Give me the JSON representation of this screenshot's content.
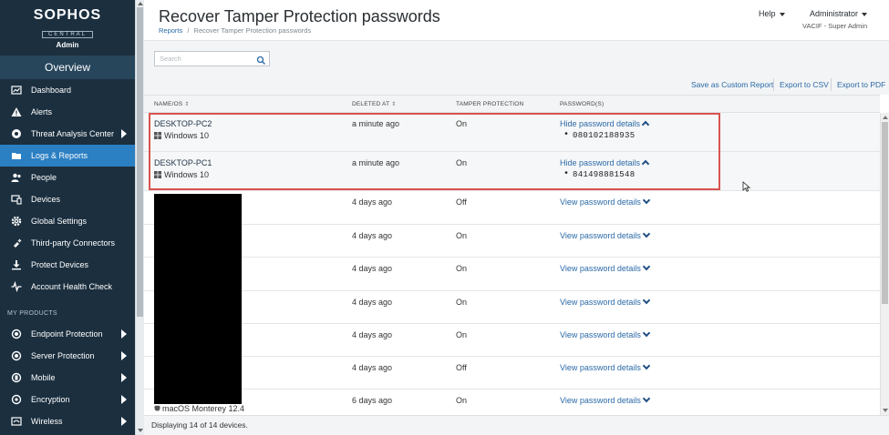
{
  "sidebar": {
    "logo_word": "SOPHOS",
    "logo_sub": "CENTRAL",
    "logo_admin": "Admin",
    "overview": "Overview",
    "items": [
      {
        "label": "Dashboard",
        "icon": "dashboard-icon"
      },
      {
        "label": "Alerts",
        "icon": "alert-icon"
      },
      {
        "label": "Threat Analysis Center",
        "icon": "threat-icon",
        "has_arrow": true
      },
      {
        "label": "Logs & Reports",
        "icon": "folder-icon",
        "active": true
      },
      {
        "label": "People",
        "icon": "people-icon"
      },
      {
        "label": "Devices",
        "icon": "devices-icon"
      },
      {
        "label": "Global Settings",
        "icon": "gear-icon"
      },
      {
        "label": "Third-party Connectors",
        "icon": "plug-icon"
      },
      {
        "label": "Protect Devices",
        "icon": "download-icon"
      },
      {
        "label": "Account Health Check",
        "icon": "pulse-icon"
      }
    ],
    "my_products_label": "MY PRODUCTS",
    "products": [
      {
        "label": "Endpoint Protection",
        "icon": "endpoint-icon",
        "has_arrow": true
      },
      {
        "label": "Server Protection",
        "icon": "server-icon",
        "has_arrow": true
      },
      {
        "label": "Mobile",
        "icon": "mobile-icon",
        "has_arrow": true
      },
      {
        "label": "Encryption",
        "icon": "encryption-icon",
        "has_arrow": true
      },
      {
        "label": "Wireless",
        "icon": "wireless-icon",
        "has_arrow": true
      }
    ]
  },
  "header": {
    "title": "Recover Tamper Protection passwords",
    "breadcrumb_root": "Reports",
    "breadcrumb_sep": "/",
    "breadcrumb_current": "Recover Tamper Protection passwords",
    "help": "Help",
    "admin": "Administrator",
    "admin_sub": "VACIF - Super Admin"
  },
  "toolbar": {
    "search_placeholder": "Search",
    "save_custom_report": "Save as Custom Report",
    "export_csv": "Export to CSV",
    "export_pdf": "Export to PDF"
  },
  "table": {
    "columns": {
      "name": "NAME/OS",
      "deleted": "DELETED AT",
      "tamper": "TAMPER PROTECTION",
      "passwords": "PASSWORD(S)"
    },
    "rows": [
      {
        "name": "DESKTOP-PC2",
        "os": "Windows 10",
        "deleted": "a minute ago",
        "tamper": "On",
        "link": "Hide password details",
        "password": "080102188935",
        "expanded": true
      },
      {
        "name": "DESKTOP-PC1",
        "os": "Windows 10",
        "deleted": "a minute ago",
        "tamper": "On",
        "link": "Hide password details",
        "password": "841498881548",
        "expanded": true
      },
      {
        "deleted": "4 days ago",
        "tamper": "Off",
        "link": "View password details"
      },
      {
        "deleted": "4 days ago",
        "tamper": "On",
        "link": "View password details"
      },
      {
        "deleted": "4 days ago",
        "tamper": "On",
        "link": "View password details"
      },
      {
        "deleted": "4 days ago",
        "tamper": "On",
        "link": "View password details"
      },
      {
        "deleted": "4 days ago",
        "tamper": "On",
        "link": "View password details"
      },
      {
        "deleted": "4 days ago",
        "tamper": "Off",
        "link": "View password details"
      },
      {
        "deleted": "6 days ago",
        "tamper": "On",
        "link": "View password details"
      }
    ],
    "partial_os": "macOS Monterey 12.4"
  },
  "footer": {
    "status": "Displaying 14 of 14 devices."
  },
  "colors": {
    "sidebar_bg": "#1b2f3f",
    "active_nav": "#2b7fc3",
    "link": "#2b6aa8",
    "highlight": "#d9534f"
  }
}
